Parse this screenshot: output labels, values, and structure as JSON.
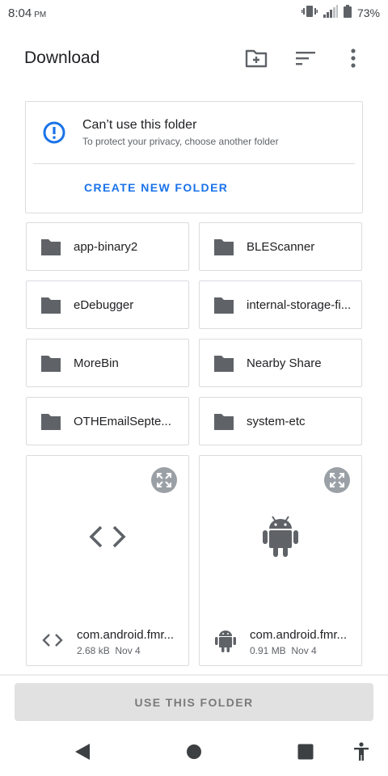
{
  "status_bar": {
    "time": "8:04",
    "ampm": "PM",
    "battery_percent": "73%"
  },
  "app_bar": {
    "title": "Download"
  },
  "warning": {
    "title": "Can’t use this folder",
    "subtitle": "To protect your privacy, choose another folder",
    "action_label": "CREATE NEW FOLDER",
    "accent_color": "#1a73e8"
  },
  "folders": [
    {
      "name": "app-binary2",
      "icon": "folder-icon"
    },
    {
      "name": "BLEScanner",
      "icon": "folder-icon"
    },
    {
      "name": "eDebugger",
      "icon": "folder-icon"
    },
    {
      "name": "internal-storage-fi...",
      "icon": "folder-icon"
    },
    {
      "name": "MoreBin",
      "icon": "folder-icon"
    },
    {
      "name": "Nearby Share",
      "icon": "folder-icon"
    },
    {
      "name": "OTHEmailSepte...",
      "icon": "folder-icon"
    },
    {
      "name": "system-etc",
      "icon": "folder-icon"
    }
  ],
  "files": [
    {
      "name": "com.android.fmr...",
      "size": "2.68 kB",
      "date": "Nov 4",
      "icon": "code-icon"
    },
    {
      "name": "com.android.fmr...",
      "size": "0.91 MB",
      "date": "Nov 4",
      "icon": "android-icon"
    }
  ],
  "bottom": {
    "use_folder_label": "USE THIS FOLDER"
  }
}
